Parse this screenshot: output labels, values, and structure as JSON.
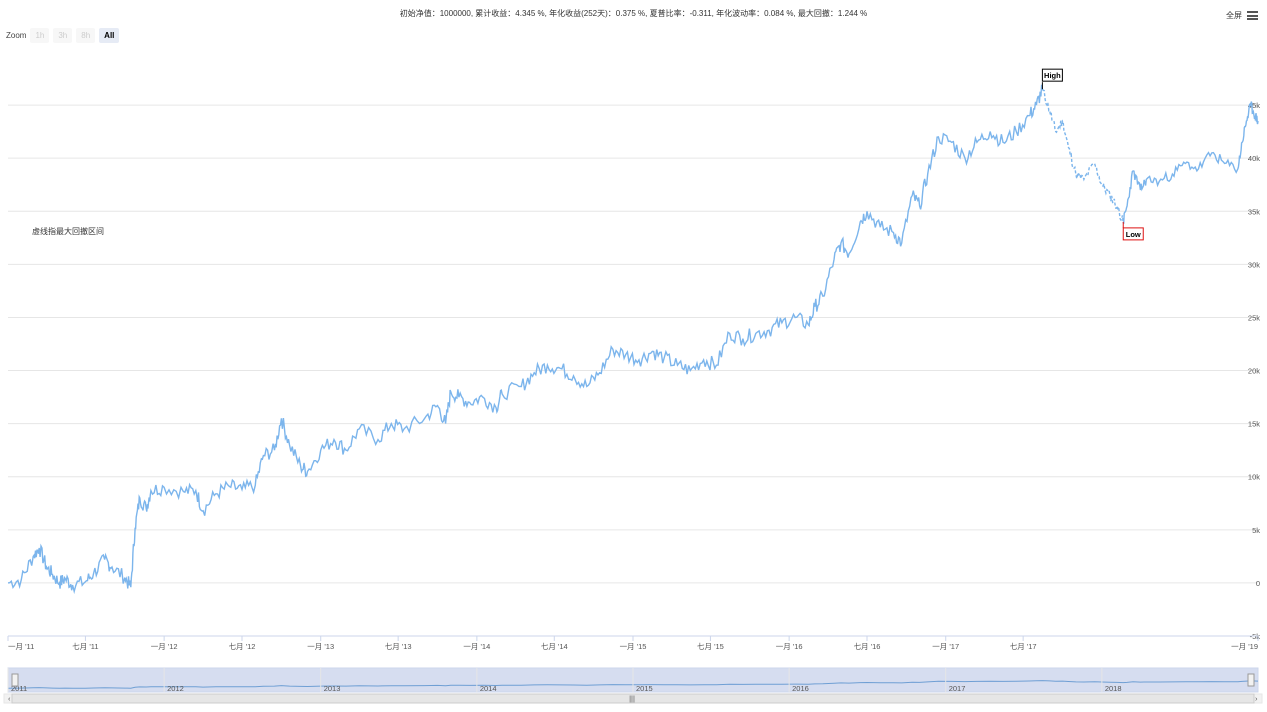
{
  "header": {
    "title": "初始净值：1000000, 累计收益：4.345 %, 年化收益(252天)：0.375 %, 夏普比率：-0.311, 年化波动率：0.084 %, 最大回撤：1.244 %",
    "fullscreen_label": "全屏"
  },
  "zoom": {
    "label": "Zoom",
    "buttons": [
      "1h",
      "3h",
      "8h",
      "All"
    ],
    "active": "All"
  },
  "annotation": "虚线指最大回撤区间",
  "chart_data": {
    "type": "line",
    "title": "",
    "xlabel": "",
    "ylabel": "",
    "ylim": [
      -5000,
      50000
    ],
    "y_ticks": [
      "-5k",
      "0",
      "5k",
      "10k",
      "15k",
      "20k",
      "25k",
      "30k",
      "35k",
      "40k",
      "45k"
    ],
    "x_ticks": [
      "一月 '11",
      "七月 '11",
      "一月 '12",
      "七月 '12",
      "一月 '13",
      "七月 '13",
      "一月 '14",
      "七月 '14",
      "一月 '15",
      "七月 '15",
      "一月 '16",
      "七月 '16",
      "一月 '17",
      "七月 '17",
      "一月 '19"
    ],
    "navigator_labels": [
      "2011",
      "2012",
      "2013",
      "2014",
      "2015",
      "2016",
      "2017",
      "2018"
    ],
    "grid": true,
    "legend": "none",
    "line_color": "#7cb5ec",
    "series": [
      {
        "values_solid": [
          [
            "2011-01-01",
            0
          ],
          [
            "2011-02-01",
            300
          ],
          [
            "2011-03-01",
            2500
          ],
          [
            "2011-03-15",
            3300
          ],
          [
            "2011-04-01",
            1500
          ],
          [
            "2011-04-15",
            800
          ],
          [
            "2011-05-01",
            0
          ],
          [
            "2011-05-15",
            400
          ],
          [
            "2011-06-01",
            -200
          ],
          [
            "2011-07-01",
            100
          ],
          [
            "2011-07-20",
            900
          ],
          [
            "2011-08-15",
            2200
          ],
          [
            "2011-09-01",
            1500
          ],
          [
            "2011-10-01",
            500
          ],
          [
            "2011-10-15",
            -400
          ],
          [
            "2011-10-25",
            5200
          ],
          [
            "2011-11-05",
            8000
          ],
          [
            "2011-11-20",
            7000
          ],
          [
            "2011-12-01",
            8700
          ],
          [
            "2012-01-01",
            9000
          ],
          [
            "2012-02-15",
            8600
          ],
          [
            "2012-03-15",
            8700
          ],
          [
            "2012-04-01",
            6800
          ],
          [
            "2012-05-01",
            8400
          ],
          [
            "2012-06-01",
            9100
          ],
          [
            "2012-07-01",
            8800
          ],
          [
            "2012-08-01",
            9200
          ],
          [
            "2012-08-20",
            12000
          ],
          [
            "2012-09-15",
            12500
          ],
          [
            "2012-10-01",
            15500
          ],
          [
            "2012-10-20",
            13000
          ],
          [
            "2012-11-15",
            11000
          ],
          [
            "2012-12-01",
            10500
          ],
          [
            "2013-01-01",
            12500
          ],
          [
            "2013-02-01",
            13500
          ],
          [
            "2013-03-01",
            12500
          ],
          [
            "2013-04-01",
            14500
          ],
          [
            "2013-05-15",
            13500
          ],
          [
            "2013-06-15",
            15000
          ],
          [
            "2013-07-15",
            14500
          ],
          [
            "2013-09-01",
            15500
          ],
          [
            "2013-10-01",
            16700
          ],
          [
            "2013-10-20",
            15000
          ],
          [
            "2013-11-01",
            18000
          ],
          [
            "2013-11-20",
            17500
          ],
          [
            "2013-12-15",
            17000
          ],
          [
            "2014-01-15",
            17500
          ],
          [
            "2014-02-15",
            16500
          ],
          [
            "2014-03-01",
            17800
          ],
          [
            "2014-04-15",
            18500
          ],
          [
            "2014-05-15",
            19800
          ],
          [
            "2014-06-15",
            20500
          ],
          [
            "2014-07-15",
            20200
          ],
          [
            "2014-08-15",
            19500
          ],
          [
            "2014-09-15",
            18500
          ],
          [
            "2014-10-15",
            19800
          ],
          [
            "2014-11-15",
            22000
          ],
          [
            "2014-12-15",
            21500
          ],
          [
            "2015-01-15",
            21000
          ],
          [
            "2015-02-15",
            21800
          ],
          [
            "2015-03-15",
            21200
          ],
          [
            "2015-04-15",
            20500
          ],
          [
            "2015-05-15",
            20000
          ],
          [
            "2015-06-15",
            21000
          ],
          [
            "2015-07-15",
            20500
          ],
          [
            "2015-08-15",
            23500
          ],
          [
            "2015-09-15",
            23000
          ],
          [
            "2015-10-15",
            23500
          ],
          [
            "2015-11-15",
            23800
          ],
          [
            "2015-12-15",
            24500
          ],
          [
            "2016-01-15",
            25000
          ],
          [
            "2016-02-15",
            24300
          ],
          [
            "2016-03-01",
            26000
          ],
          [
            "2016-03-20",
            27000
          ],
          [
            "2016-04-15",
            30500
          ],
          [
            "2016-05-01",
            32000
          ],
          [
            "2016-05-20",
            31000
          ],
          [
            "2016-06-15",
            34000
          ],
          [
            "2016-07-01",
            35000
          ],
          [
            "2016-08-01",
            33500
          ],
          [
            "2016-09-01",
            33000
          ],
          [
            "2016-09-20",
            32000
          ],
          [
            "2016-10-15",
            36500
          ],
          [
            "2016-11-01",
            35500
          ],
          [
            "2016-11-20",
            38500
          ],
          [
            "2016-12-15",
            42000
          ],
          [
            "2017-01-15",
            41500
          ],
          [
            "2017-02-15",
            40000
          ],
          [
            "2017-03-15",
            41500
          ],
          [
            "2017-04-15",
            42500
          ],
          [
            "2017-05-15",
            41500
          ],
          [
            "2017-06-15",
            42500
          ],
          [
            "2017-07-15",
            44000
          ],
          [
            "2017-08-01",
            45000
          ],
          [
            "2017-08-15",
            46500
          ]
        ],
        "values_dashed": [
          [
            "2017-08-15",
            46500
          ],
          [
            "2017-09-01",
            44500
          ],
          [
            "2017-09-15",
            42500
          ],
          [
            "2017-10-01",
            43500
          ],
          [
            "2017-10-15",
            41000
          ],
          [
            "2017-11-01",
            38500
          ],
          [
            "2017-11-20",
            38000
          ],
          [
            "2017-12-15",
            39500
          ],
          [
            "2018-01-01",
            37500
          ],
          [
            "2018-01-20",
            36500
          ],
          [
            "2018-02-05",
            35500
          ],
          [
            "2018-02-20",
            34000
          ]
        ],
        "values_recovery": [
          [
            "2018-02-20",
            34000
          ],
          [
            "2018-03-01",
            35500
          ],
          [
            "2018-03-15",
            38800
          ],
          [
            "2018-04-01",
            37000
          ],
          [
            "2018-04-15",
            38000
          ],
          [
            "2018-05-15",
            37800
          ],
          [
            "2018-06-15",
            38500
          ],
          [
            "2018-07-15",
            39500
          ],
          [
            "2018-08-15",
            39000
          ],
          [
            "2018-09-15",
            40500
          ],
          [
            "2018-10-15",
            39500
          ],
          [
            "2018-11-15",
            39000
          ],
          [
            "2018-11-25",
            41500
          ],
          [
            "2018-12-05",
            43500
          ],
          [
            "2018-12-15",
            45000
          ],
          [
            "2018-12-25",
            44000
          ],
          [
            "2019-01-01",
            43500
          ]
        ]
      }
    ],
    "flags": [
      {
        "text": "High",
        "date": "2017-08-15",
        "value": 46500,
        "color": "#000000"
      },
      {
        "text": "Low",
        "date": "2018-02-20",
        "value": 34000,
        "color": "#d11"
      }
    ]
  }
}
